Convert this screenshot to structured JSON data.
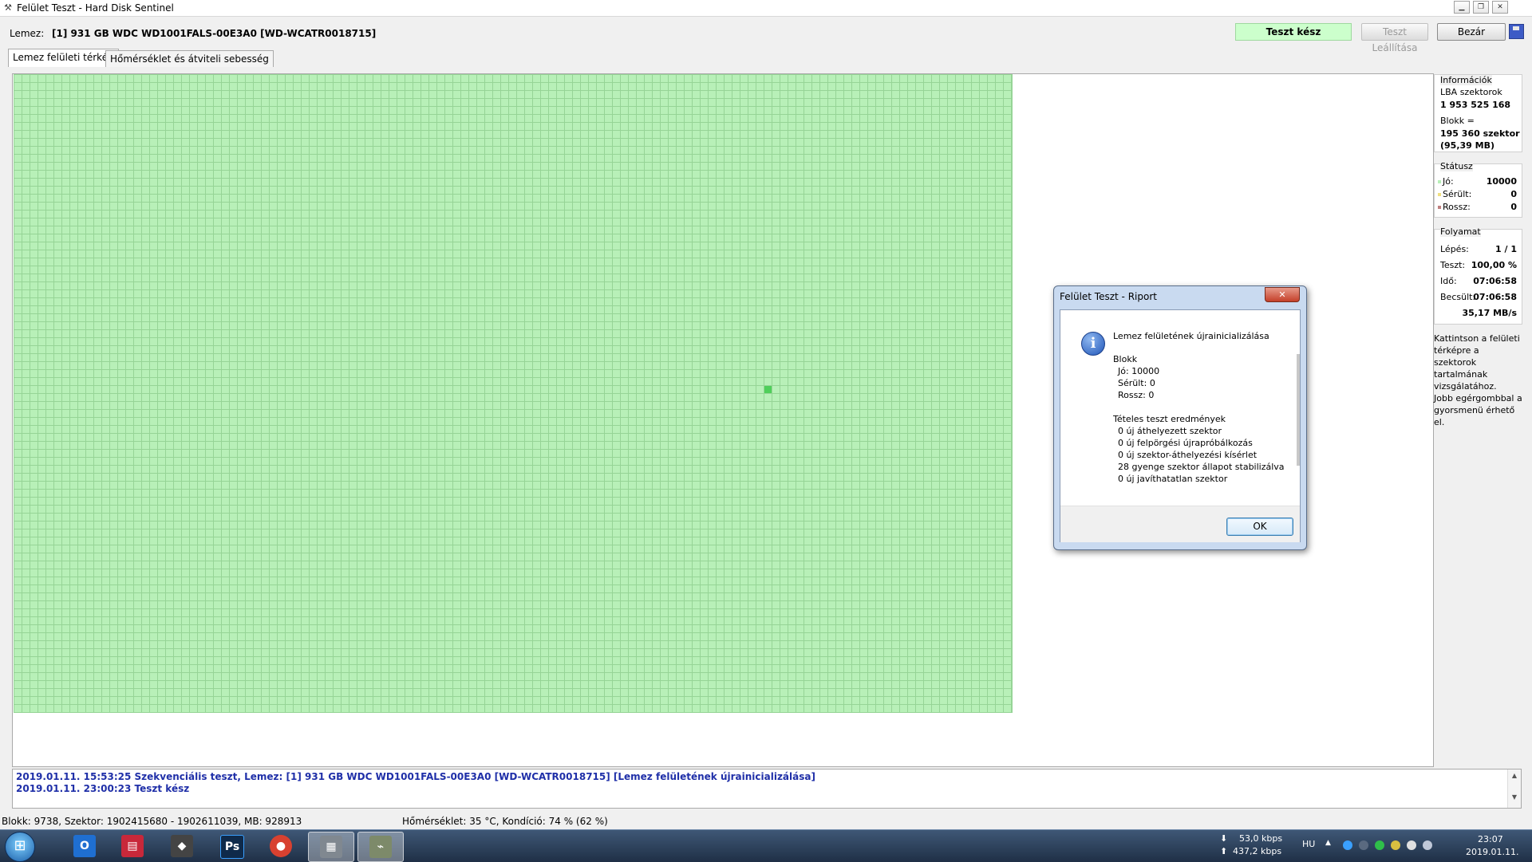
{
  "window": {
    "title": "Felület Teszt - Hard Disk Sentinel",
    "min_icon": "minimize-icon",
    "max_icon": "maximize-icon",
    "close_icon": "close-icon"
  },
  "toolbar": {
    "disk_label": "Lemez:",
    "disk_value": "[1] 931 GB  WDC WD1001FALS-00E3A0 [WD-WCATR0018715]",
    "status": "Teszt kész",
    "stop_label": "Teszt Leállítása",
    "close_label": "Bezár",
    "save_icon": "save-icon"
  },
  "tabs": [
    {
      "label": "Lemez felületi térkép",
      "active": true
    },
    {
      "label": "Hőmérséklet és átviteli sebesség",
      "active": false
    }
  ],
  "grid": {
    "block_count": 10000,
    "color_good": "#b8f0b8",
    "color_highlight": "#4fcf5a"
  },
  "info": {
    "title": "Információk",
    "lba_label": "LBA szektorok",
    "lba_value": "1 953 525 168",
    "block_label": "Blokk =",
    "block_value": "195 360 szektor",
    "block_mb": "(95,39 MB)"
  },
  "status": {
    "title": "Státusz",
    "good_label": "Jó:",
    "good_value": "10000",
    "damaged_label": "Sérült:",
    "damaged_value": "0",
    "bad_label": "Rossz:",
    "bad_value": "0",
    "good_color": "#b8f0b8",
    "damaged_color": "#f0e080",
    "bad_color": "#c08080"
  },
  "progress": {
    "title": "Folyamat",
    "step_label": "Lépés:",
    "step_value": "1 / 1",
    "test_label": "Teszt:",
    "test_value": "100,00 %",
    "time_label": "Idő:",
    "time_value": "07:06:58",
    "est_label": "Becsült:",
    "est_value": "07:06:58",
    "speed_value": "35,17 MB/s"
  },
  "hint1": "Kattintson a felületi térképre a szektorok tartalmának vizsgálatához.",
  "hint2": "Jobb egérgombbal a gyorsmenü érhető el.",
  "log": [
    "2019.01.11.  15:53:25   Szekvenciális teszt, Lemez: [1] 931 GB  WDC WD1001FALS-00E3A0 [WD-WCATR0018715] [Lemez felületének újrainicializálása]",
    "2019.01.11.  23:00:23   Teszt kész"
  ],
  "statusbar": {
    "left": "Blokk: 9738, Szektor: 1902415680 - 1902611039, MB: 928913",
    "right": "Hőmérséklet: 35  °C,  Kondíció: 74 % (62 %)"
  },
  "dialog": {
    "title": "Felület Teszt - Riport",
    "close_label": "✕",
    "heading": "Lemez felületének újrainicializálása",
    "block_title": "Blokk",
    "block_good": "Jó: 10000",
    "block_damaged": "Sérült: 0",
    "block_bad": "Rossz: 0",
    "results_title": "Tételes teszt eredmények",
    "r1": "0 új áthelyezett szektor",
    "r2": "0 új felpörgési újrapróbálkozás",
    "r3": "0 új szektor-áthelyezési kísérlet",
    "r4": "28 gyenge szektor állapot stabilizálva",
    "r5": "0 új javíthatatlan szektor",
    "ok_label": "OK",
    "icon": "info-icon"
  },
  "taskbar": {
    "apps": [
      {
        "name": "outlook",
        "glyph": "O",
        "color": "#1f6fd1"
      },
      {
        "name": "save-disk",
        "glyph": "▤",
        "color": "#c8283a"
      },
      {
        "name": "alien",
        "glyph": "◆",
        "color": "#444"
      },
      {
        "name": "photoshop",
        "glyph": "Ps",
        "color": "#0f2a4a"
      },
      {
        "name": "chrome",
        "glyph": "●",
        "color": "#d84130"
      },
      {
        "name": "disk-tool",
        "glyph": "▦",
        "color": "#808890"
      },
      {
        "name": "hd-sentinel",
        "glyph": "⌁",
        "color": "#7d8a6a"
      }
    ],
    "net_down": "53,0 kbps",
    "net_up": "437,2 kbps",
    "lang": "HU",
    "time": "23:07",
    "date": "2019.01.11."
  }
}
